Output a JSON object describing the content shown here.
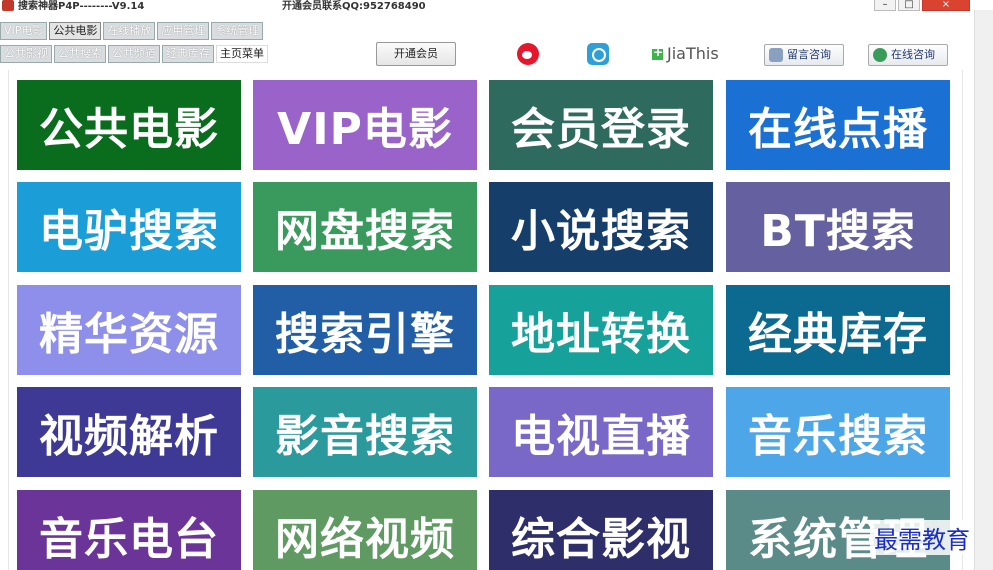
{
  "titlebar": {
    "app_title": "搜索神器P4P--------V9.14",
    "contact": "开通会员联系QQ:952768490"
  },
  "tabs_row1": [
    "VIP电影",
    "公共电影",
    "在线播放",
    "应用管理",
    "系统管理"
  ],
  "tabs_row2": [
    "公共影视",
    "公共搜索",
    "公共频道",
    "经典库存",
    "主页菜单"
  ],
  "toolbar": {
    "vip_button": "开通会员",
    "jiathis": "JiaThis",
    "message_consult": "留言咨询",
    "online_consult": "在线咨询"
  },
  "tiles": [
    {
      "label": "公共电影",
      "color": "#0a6d1e"
    },
    {
      "label": "VIP电影",
      "color": "#9a63c9"
    },
    {
      "label": "会员登录",
      "color": "#2f6a5e"
    },
    {
      "label": "在线点播",
      "color": "#1a70d3"
    },
    {
      "label": "电驴搜索",
      "color": "#1b9ed8"
    },
    {
      "label": "网盘搜索",
      "color": "#3a9a5e"
    },
    {
      "label": "小说搜索",
      "color": "#163e6a"
    },
    {
      "label": "BT搜索",
      "color": "#6561a0"
    },
    {
      "label": "精华资源",
      "color": "#8e8fea"
    },
    {
      "label": "搜索引擎",
      "color": "#215ea6"
    },
    {
      "label": "地址转换",
      "color": "#16a19a"
    },
    {
      "label": "经典库存",
      "color": "#0c6990"
    },
    {
      "label": "视频解析",
      "color": "#3d3994"
    },
    {
      "label": "影音搜索",
      "color": "#2b9a9c"
    },
    {
      "label": "电视直播",
      "color": "#7a68c8"
    },
    {
      "label": "音乐搜索",
      "color": "#4da6e8"
    },
    {
      "label": "音乐电台",
      "color": "#6a3498"
    },
    {
      "label": "网络视频",
      "color": "#5f9a62"
    },
    {
      "label": "综合影视",
      "color": "#2e2f6a"
    },
    {
      "label": "系统管理",
      "color": "#5a8b88"
    }
  ],
  "watermark": "最需教育"
}
